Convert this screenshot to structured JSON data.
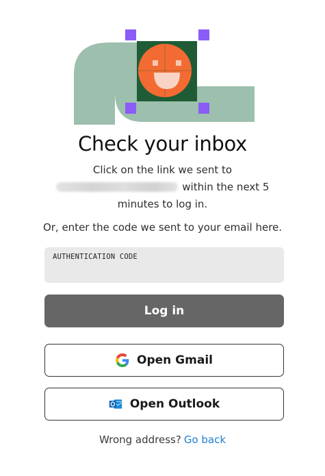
{
  "heading": {
    "title": "Check your inbox",
    "line1": "Click on the link we sent to",
    "line2_suffix": "within the next 5",
    "line3": "minutes to log in."
  },
  "code_section": {
    "instruction": "Or, enter the code we sent to your email here.",
    "field_label": "AUTHENTICATION CODE",
    "field_value": ""
  },
  "buttons": {
    "login_label": "Log in",
    "gmail_label": "Open Gmail",
    "outlook_label": "Open Outlook"
  },
  "footer": {
    "prompt": "Wrong address?",
    "link_label": "Go back"
  },
  "icons": {
    "illustration": "smiley-face-illustration",
    "gmail": "google-g-icon",
    "outlook": "outlook-icon"
  },
  "colors": {
    "login_button": "#666666",
    "link": "#1f7fd1",
    "field_background": "#e9e9e9",
    "illustration_shape": "#9dbfae",
    "illustration_square": "#1f5c36",
    "smiley": "#f36b32",
    "selection_handles": "#8b5cf6"
  }
}
